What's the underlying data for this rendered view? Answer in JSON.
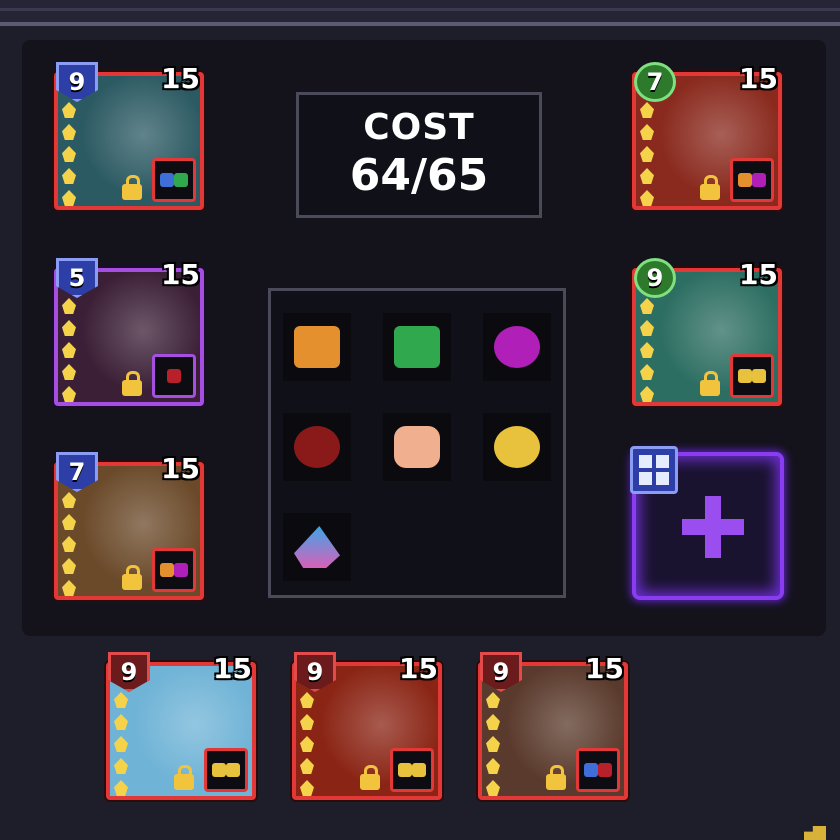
{
  "cost": {
    "label": "COST",
    "value": "64/65"
  },
  "colors": {
    "frame_red": "#e33838",
    "frame_purple": "#a44fe0",
    "accent_purple": "#9a4ef0",
    "gold": "#f4d24a"
  },
  "heroes": [
    {
      "slot": "left-1",
      "level": "9",
      "cost": "15",
      "badge": "blue",
      "frame": "red",
      "art": "#2c5a63",
      "synergy": [
        "#3f6ed8",
        "#2fa84e"
      ]
    },
    {
      "slot": "left-2",
      "level": "5",
      "cost": "15",
      "badge": "blue",
      "frame": "purple",
      "art": "#3b1f36",
      "synergy": [
        "#b8202a"
      ]
    },
    {
      "slot": "left-3",
      "level": "7",
      "cost": "15",
      "badge": "blue",
      "frame": "red",
      "art": "#6b4a2a",
      "synergy": [
        "#e5902e",
        "#b020b8"
      ]
    },
    {
      "slot": "right-1",
      "level": "7",
      "cost": "15",
      "badge": "green",
      "frame": "red",
      "art": "#8a2a1e",
      "synergy": [
        "#e5902e",
        "#b020b8"
      ]
    },
    {
      "slot": "right-2",
      "level": "9",
      "cost": "15",
      "badge": "green",
      "frame": "red",
      "art": "#2d6e62",
      "synergy": [
        "#e8c23c",
        "#e8c23c"
      ]
    },
    {
      "slot": "bottom-1",
      "level": "9",
      "cost": "15",
      "badge": "red",
      "frame": "red",
      "art": "#6fb3d6",
      "synergy": [
        "#e8c23c",
        "#e8c23c"
      ]
    },
    {
      "slot": "bottom-2",
      "level": "9",
      "cost": "15",
      "badge": "red",
      "frame": "red",
      "art": "#8a2414",
      "synergy": [
        "#e8c23c",
        "#e8c23c"
      ]
    },
    {
      "slot": "bottom-3",
      "level": "9",
      "cost": "15",
      "badge": "red",
      "frame": "red",
      "art": "#5a3a2c",
      "synergy": [
        "#3f6ed8",
        "#b8202a"
      ]
    }
  ],
  "synergies": [
    {
      "icon": "orange-shield-icon",
      "color": "#e5902e"
    },
    {
      "icon": "green-slime-icon",
      "color": "#2fa84e"
    },
    {
      "icon": "purple-gear-icon",
      "color": "#b020b8"
    },
    {
      "icon": "red-claw-icon",
      "color": "#8a1a1a"
    },
    {
      "icon": "peach-face-icon",
      "color": "#f0b090"
    },
    {
      "icon": "yellow-mask-icon",
      "color": "#e8c23c"
    },
    {
      "icon": "blue-flame-icon",
      "color": "#3ea6e8"
    }
  ]
}
